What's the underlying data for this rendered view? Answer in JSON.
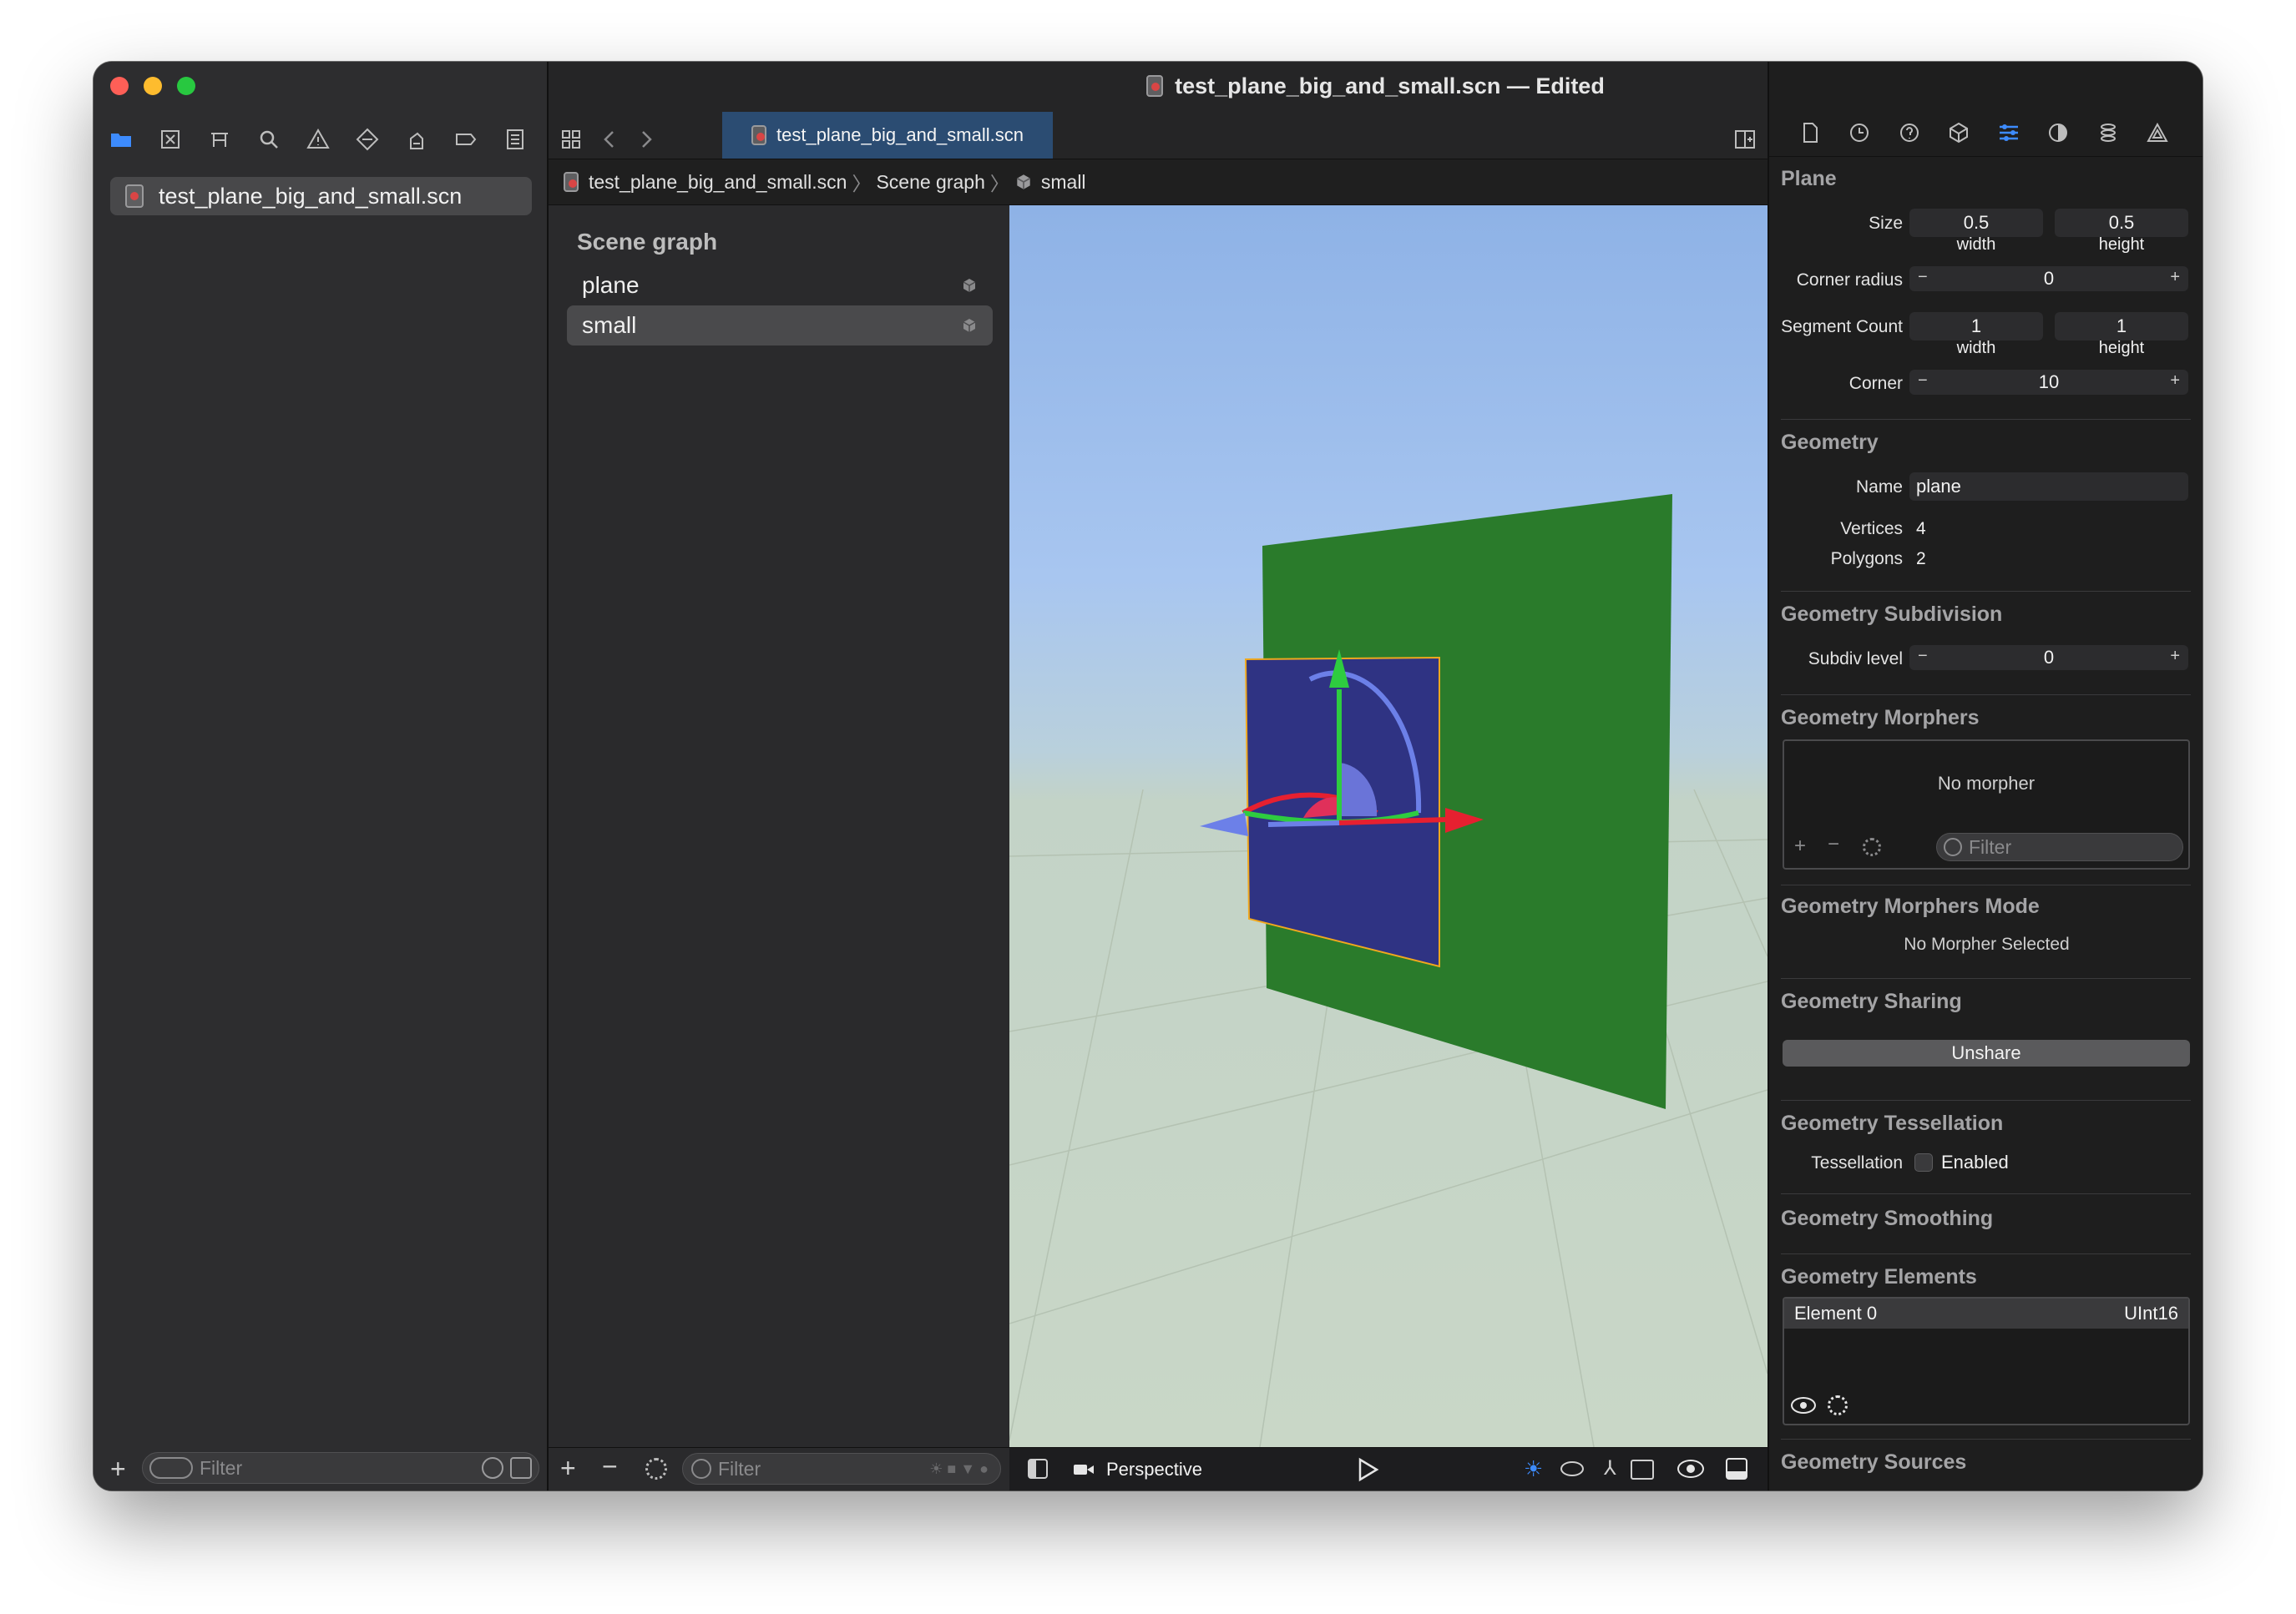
{
  "window": {
    "title": "test_plane_big_and_small.scn — Edited"
  },
  "navigator": {
    "file_name": "test_plane_big_and_small.scn",
    "filter_placeholder": "Filter"
  },
  "editor": {
    "tab_label": "test_plane_big_and_small.scn",
    "breadcrumb": [
      "test_plane_big_and_small.scn",
      "Scene graph",
      "small"
    ]
  },
  "scene_graph": {
    "heading": "Scene graph",
    "nodes": [
      {
        "name": "plane",
        "selected": false
      },
      {
        "name": "small",
        "selected": true
      }
    ],
    "filter_placeholder": "Filter"
  },
  "viewport": {
    "camera_label": "Perspective",
    "accent_color": "#3d8bfd"
  },
  "inspector": {
    "plane": {
      "title": "Plane",
      "size_label": "Size",
      "size_width": "0.5",
      "size_height": "0.5",
      "width_label": "width",
      "height_label": "height",
      "corner_radius_label": "Corner radius",
      "corner_radius": "0",
      "segment_count_label": "Segment Count",
      "segment_width": "1",
      "segment_height": "1",
      "corner_label": "Corner",
      "corner": "10"
    },
    "geometry": {
      "title": "Geometry",
      "name_label": "Name",
      "name": "plane",
      "vertices_label": "Vertices",
      "vertices": "4",
      "polygons_label": "Polygons",
      "polygons": "2"
    },
    "subdivision": {
      "title": "Geometry Subdivision",
      "level_label": "Subdiv level",
      "level": "0"
    },
    "morphers": {
      "title": "Geometry Morphers",
      "empty": "No morpher",
      "filter_placeholder": "Filter"
    },
    "morphers_mode": {
      "title": "Geometry Morphers Mode",
      "empty": "No Morpher Selected"
    },
    "sharing": {
      "title": "Geometry Sharing",
      "button": "Unshare"
    },
    "tessellation": {
      "title": "Geometry Tessellation",
      "label": "Tessellation",
      "checkbox": "Enabled"
    },
    "smoothing": {
      "title": "Geometry Smoothing"
    },
    "elements": {
      "title": "Geometry Elements",
      "rows": [
        {
          "name": "Element 0",
          "type": "UInt16"
        }
      ]
    },
    "sources": {
      "title": "Geometry Sources"
    }
  }
}
